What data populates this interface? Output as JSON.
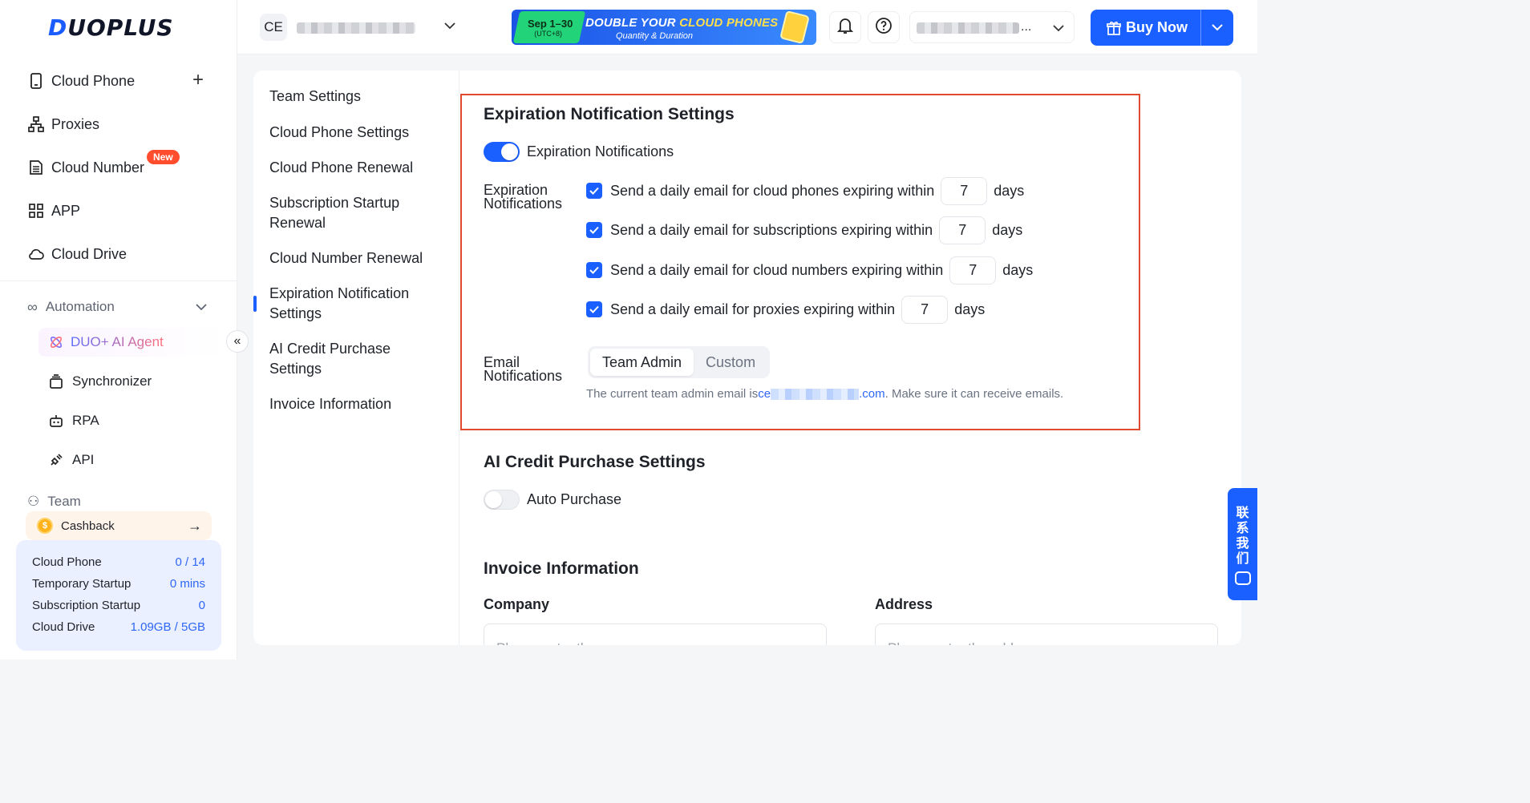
{
  "brand": {
    "logo_text_a": "D",
    "logo_text_b": "UOPLUS"
  },
  "sidebar": {
    "items": [
      {
        "label": "Cloud Phone",
        "icon": "phone-icon"
      },
      {
        "label": "Proxies",
        "icon": "network-icon"
      },
      {
        "label": "Cloud Number",
        "icon": "sim-card-icon",
        "badge": "New"
      },
      {
        "label": "APP",
        "icon": "grid-icon"
      },
      {
        "label": "Cloud Drive",
        "icon": "cloud-icon"
      }
    ],
    "automation": {
      "title": "Automation",
      "items": [
        {
          "label": "DUO+ AI Agent",
          "icon": "ai-agent-icon"
        },
        {
          "label": "Synchronizer",
          "icon": "synchronizer-icon"
        },
        {
          "label": "RPA",
          "icon": "robot-icon"
        },
        {
          "label": "API",
          "icon": "plug-icon"
        }
      ]
    },
    "team_title": "Team",
    "cashback": "Cashback",
    "usage": [
      {
        "label": "Cloud Phone",
        "value": "0 / 14"
      },
      {
        "label": "Temporary Startup",
        "value": "0 mins"
      },
      {
        "label": "Subscription Startup",
        "value": "0"
      },
      {
        "label": "Cloud Drive",
        "value": "1.09GB / 5GB"
      }
    ]
  },
  "topbar": {
    "workspace_initials": "CE",
    "promo": {
      "date": "Sep 1–30",
      "tz": "(UTC+8)",
      "headline_a": "DOUBLE YOUR ",
      "headline_b": "CLOUD PHONES",
      "subline": "Quantity & Duration"
    },
    "account_ellipsis": "...",
    "buy_label": "Buy Now"
  },
  "settings_nav": [
    "Team Settings",
    "Cloud Phone Settings",
    "Cloud Phone Renewal",
    "Subscription Startup Renewal",
    "Cloud Number Renewal",
    "Expiration Notification Settings",
    "AI Credit Purchase Settings",
    "Invoice Information"
  ],
  "expiration": {
    "title": "Expiration Notification Settings",
    "toggle_label": "Expiration Notifications",
    "toggle_on": true,
    "group_label": "Expiration Notifications",
    "rows": [
      {
        "text": "Send a daily email for cloud phones expiring within",
        "days": "7",
        "unit": "days"
      },
      {
        "text": "Send a daily email for subscriptions expiring within",
        "days": "7",
        "unit": "days"
      },
      {
        "text": "Send a daily email for cloud numbers expiring within",
        "days": "7",
        "unit": "days"
      },
      {
        "text": "Send a daily email for proxies expiring within",
        "days": "7",
        "unit": "days"
      }
    ],
    "email_label": "Email Notifications",
    "email_options": [
      "Team Admin",
      "Custom"
    ],
    "hint_prefix": "The current team admin email is ",
    "hint_email_start": "ce",
    "hint_email_end": ".com",
    "hint_suffix": ". Make sure it can receive emails."
  },
  "ai_credit": {
    "title": "AI Credit Purchase Settings",
    "toggle_label": "Auto Purchase",
    "toggle_on": false
  },
  "invoice": {
    "title": "Invoice Information",
    "company_label": "Company",
    "company_placeholder": "Please enter the company",
    "address_label": "Address",
    "address_placeholder": "Please enter the address"
  },
  "contact_us": [
    "联",
    "系",
    "我",
    "们"
  ],
  "colors": {
    "accent": "#1a5fff",
    "highlight_border": "#e24a2f",
    "new_badge": "#ff4d2e"
  }
}
